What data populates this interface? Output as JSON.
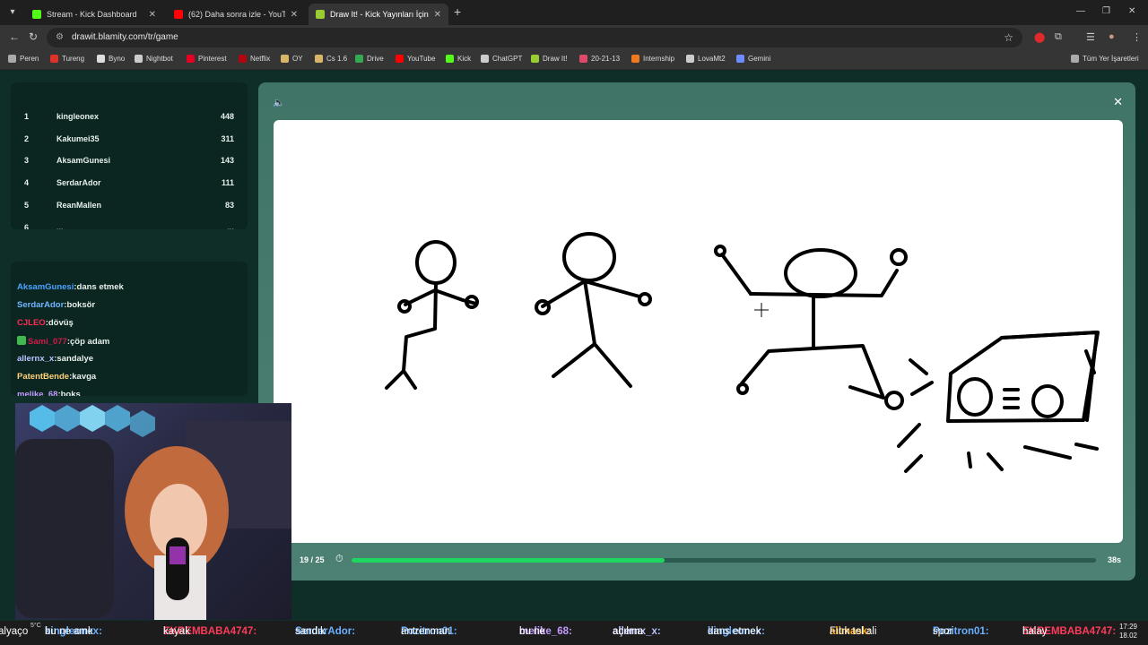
{
  "browser": {
    "tabs": [
      {
        "label": "Stream - Kick Dashboard",
        "color": "#53fc18"
      },
      {
        "label": "(62) Daha sonra izle - YouTube",
        "color": "#ff0000"
      },
      {
        "label": "Draw It! - Kick Yayınları İçin Çiz",
        "color": "#9acd32"
      }
    ],
    "url": "drawit.blamity.com/tr/game",
    "bookmarks": [
      "Peren",
      "Tureng",
      "Byno",
      "Nightbot",
      "Pinterest",
      "Netflix",
      "OY",
      "Cs 1.6",
      "Drive",
      "YouTube",
      "Kick",
      "ChatGPT",
      "Draw It!",
      "20-21-13",
      "Internship",
      "LovaMt2",
      "Gemini"
    ],
    "all_bookmarks": "Tüm Yer İşaretleri"
  },
  "leaderboard": [
    {
      "rank": "1",
      "name": "kingleonex",
      "score": "448"
    },
    {
      "rank": "2",
      "name": "Kakumei35",
      "score": "311"
    },
    {
      "rank": "3",
      "name": "AksamGunesi",
      "score": "143"
    },
    {
      "rank": "4",
      "name": "SerdarAdor",
      "score": "111"
    },
    {
      "rank": "5",
      "name": "ReanMallen",
      "score": "83"
    },
    {
      "rank": "6",
      "name": "...",
      "score": "..."
    }
  ],
  "chat": [
    {
      "user": "AksamGunesi",
      "text": "dans etmek",
      "color": "#4aa3ff"
    },
    {
      "user": "SerdarAdor",
      "text": "boksör",
      "color": "#6fb7ff"
    },
    {
      "user": "CJLEO",
      "text": "dövüş",
      "color": "#ff2a55"
    },
    {
      "user": "Sami_077",
      "text": "çöp adam",
      "color": "#d01a4a"
    },
    {
      "user": "allernx_x",
      "text": "sandalye",
      "color": "#b9c3ff"
    },
    {
      "user": "PatentBende",
      "text": "kavga",
      "color": "#ffd27a"
    },
    {
      "user": "melike_68",
      "text": "boks",
      "color": "#c39bff"
    }
  ],
  "game": {
    "round": "19 / 25",
    "time_left": "38s",
    "progress": 0.42
  },
  "ticker": [
    {
      "user": "",
      "text": "alyaço",
      "color": "#ffffff"
    },
    {
      "user": "kingleonex:",
      "text": "bu ne amk",
      "color": "#6ab0ff"
    },
    {
      "user": "EKREMBABA4747:",
      "text": "kayak",
      "color": "#ff3b5c"
    },
    {
      "user": "SerdarAdor:",
      "text": "sandık",
      "color": "#6ab0ff"
    },
    {
      "user": "Pozitron01:",
      "text": "antrenman",
      "color": "#6ab0ff"
    },
    {
      "user": "melike_68:",
      "text": "bu ne",
      "color": "#c39bff"
    },
    {
      "user": "allernx_x:",
      "text": "açılma",
      "color": "#b9c3ff"
    },
    {
      "user": "kingleonex:",
      "text": "dans etmek",
      "color": "#6ab0ff"
    },
    {
      "user": "alimask:",
      "text": "Fıtık tel ali",
      "color": "#ffb020"
    },
    {
      "user": "Pozitron01:",
      "text": "spor",
      "color": "#6ab0ff"
    },
    {
      "user": "EKREMBABA4747:",
      "text": "halay",
      "color": "#ff3b5c"
    }
  ],
  "tray": {
    "time": "17:29",
    "date": "18.02",
    "weather": "5°C"
  }
}
